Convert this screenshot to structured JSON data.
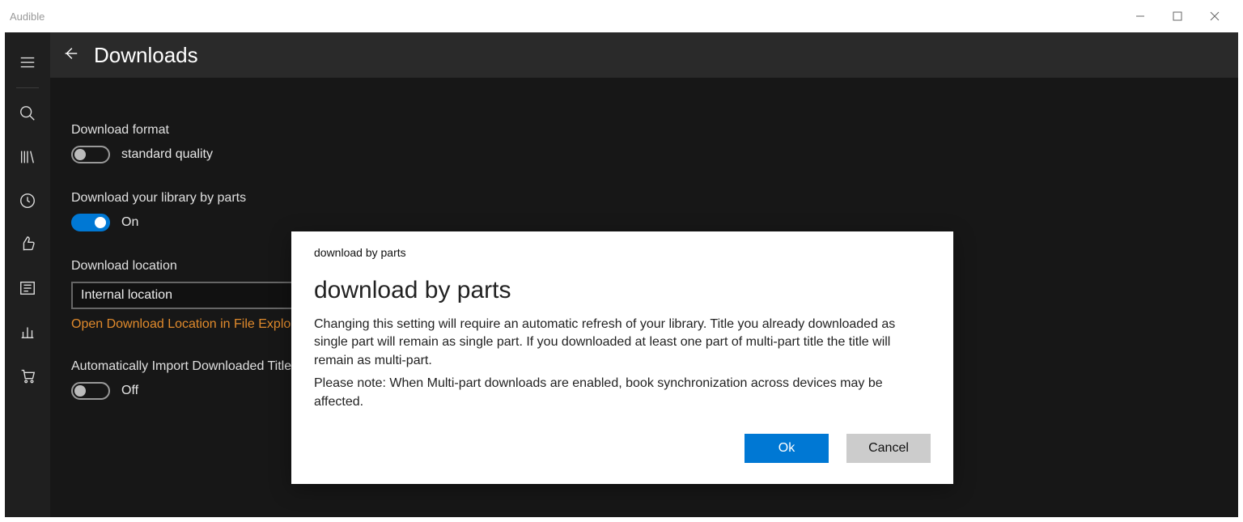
{
  "window": {
    "title": "Audible"
  },
  "header": {
    "title": "Downloads"
  },
  "settings": {
    "format_label": "Download format",
    "format_state": "standard quality",
    "parts_label": "Download your library by parts",
    "parts_state": "On",
    "location_label": "Download location",
    "location_value": "Internal location",
    "open_location_link": "Open Download Location in File Explorer",
    "auto_import_label": "Automatically Import Downloaded Titles",
    "auto_import_state": "Off"
  },
  "modal": {
    "small_title": "download by parts",
    "title": "download by parts",
    "body1": "Changing this setting will require an automatic refresh of your library. Title you already downloaded as single part will remain as single part. If you downloaded at least one part of multi-part title the title will remain as multi-part.",
    "body2": "Please note: When Multi-part downloads are enabled, book synchronization across devices may be affected.",
    "ok": "Ok",
    "cancel": "Cancel"
  }
}
